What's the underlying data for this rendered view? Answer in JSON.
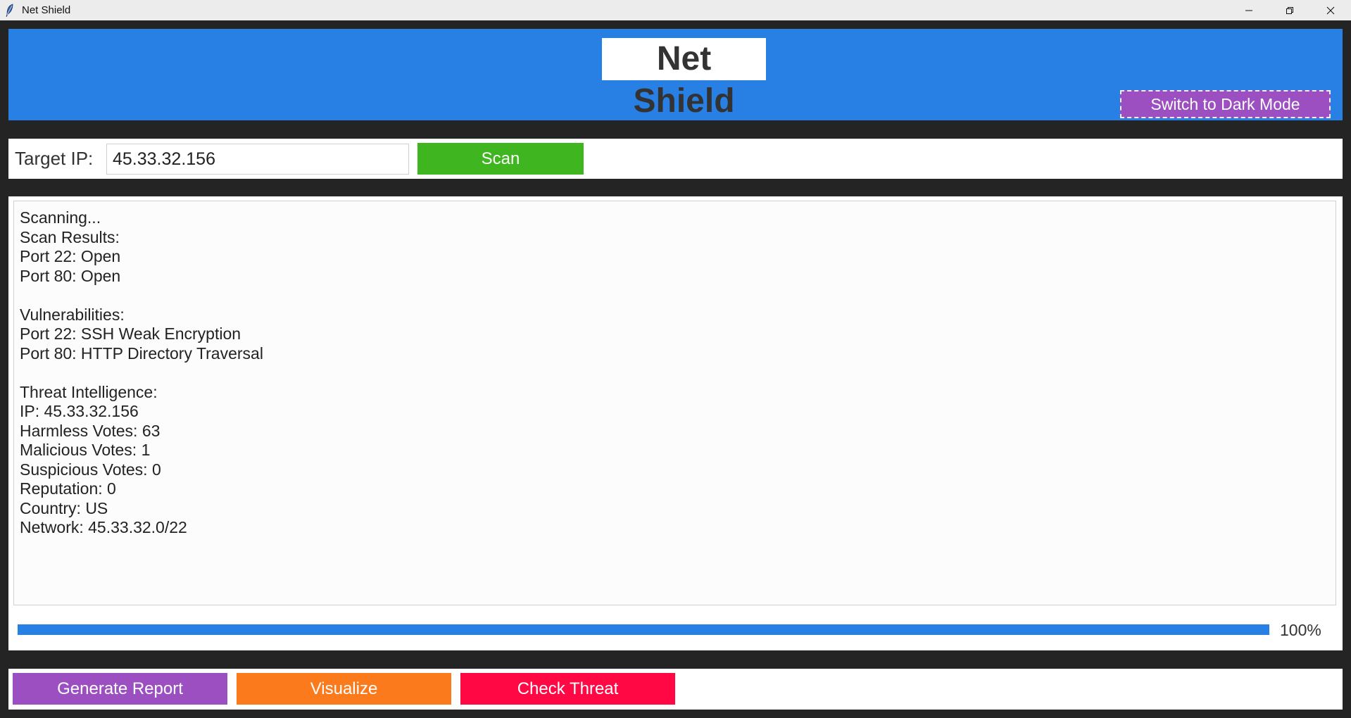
{
  "window": {
    "title": "Net Shield"
  },
  "header": {
    "title": "Net Shield",
    "dark_mode_label": "Switch to Dark Mode"
  },
  "target": {
    "label": "Target IP:",
    "value": "45.33.32.156",
    "scan_label": "Scan"
  },
  "results": {
    "lines": [
      "Scanning...",
      "Scan Results:",
      "Port 22: Open",
      "Port 80: Open",
      "",
      "Vulnerabilities:",
      "Port 22: SSH Weak Encryption",
      "Port 80: HTTP Directory Traversal",
      "",
      "Threat Intelligence:",
      "IP: 45.33.32.156",
      "Harmless Votes: 63",
      "Malicious Votes: 1",
      "Suspicious Votes: 0",
      "Reputation: 0",
      "Country: US",
      "Network: 45.33.32.0/22"
    ]
  },
  "progress": {
    "percent": 100,
    "label": "100%"
  },
  "actions": {
    "report_label": "Generate Report",
    "visualize_label": "Visualize",
    "threat_label": "Check Threat"
  },
  "colors": {
    "header_blue": "#2980e4",
    "scan_green": "#3fb51f",
    "purple": "#9b4fc0",
    "orange": "#fb7b1c",
    "red": "#ff0843"
  }
}
